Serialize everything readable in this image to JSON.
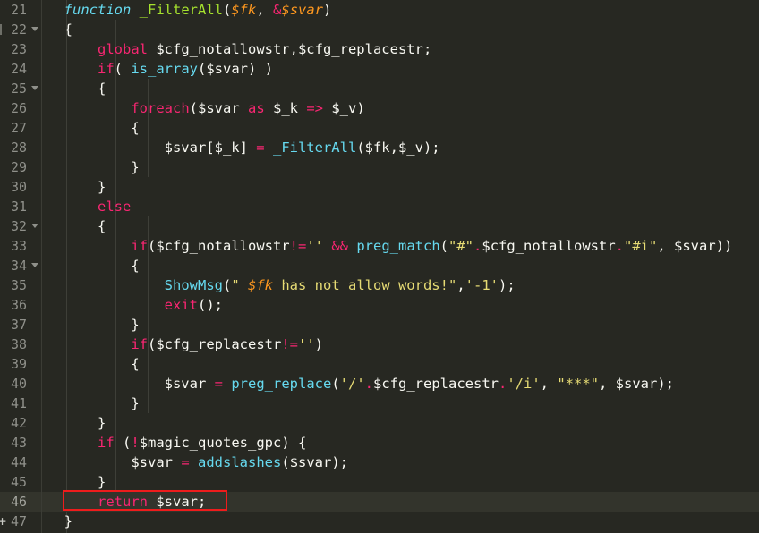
{
  "editor": {
    "theme_name": "monokai",
    "colors": {
      "background": "#272822",
      "gutter_background": "#272822",
      "gutter_text": "#8f908a",
      "current_line_background": "#33342c",
      "default_text": "#f8f8f2",
      "keyword": "#f92672",
      "function_name": "#a6e22e",
      "builtin_call": "#66d9ef",
      "parameter": "#fd971f",
      "string": "#e6db74",
      "indent_guide": "#3e3f38",
      "annotation_red": "#ee1c1c"
    },
    "language": "php",
    "current_line_number": 46,
    "first_line_number": 21,
    "last_line_number": 47
  },
  "annotation": {
    "type": "rectangle-highlight",
    "color": "#ee1c1c",
    "target_line": 46,
    "target_text": "return $svar;"
  },
  "lines": [
    {
      "number": "21",
      "fold": "none",
      "edge_tick": false,
      "tokens": [
        {
          "text": "  ",
          "cls": "punc"
        },
        {
          "text": "function",
          "cls": "kw-it"
        },
        {
          "text": " ",
          "cls": "punc"
        },
        {
          "text": "_FilterAll",
          "cls": "fn"
        },
        {
          "text": "(",
          "cls": "punc"
        },
        {
          "text": "$fk",
          "cls": "param"
        },
        {
          "text": ", ",
          "cls": "punc"
        },
        {
          "text": "&",
          "cls": "op"
        },
        {
          "text": "$svar",
          "cls": "param"
        },
        {
          "text": ")",
          "cls": "punc"
        }
      ]
    },
    {
      "number": "22",
      "fold": "open",
      "edge_tick": true,
      "tokens": [
        {
          "text": "  {",
          "cls": "punc"
        }
      ]
    },
    {
      "number": "23",
      "fold": "none",
      "edge_tick": false,
      "tokens": [
        {
          "text": "      ",
          "cls": "punc"
        },
        {
          "text": "global",
          "cls": "kw"
        },
        {
          "text": " $cfg_notallowstr,$cfg_replacestr;",
          "cls": "var"
        }
      ]
    },
    {
      "number": "24",
      "fold": "none",
      "edge_tick": false,
      "tokens": [
        {
          "text": "      ",
          "cls": "punc"
        },
        {
          "text": "if",
          "cls": "kw"
        },
        {
          "text": "( ",
          "cls": "punc"
        },
        {
          "text": "is_array",
          "cls": "call"
        },
        {
          "text": "($svar) )",
          "cls": "punc"
        }
      ]
    },
    {
      "number": "25",
      "fold": "open",
      "edge_tick": false,
      "tokens": [
        {
          "text": "      {",
          "cls": "punc"
        }
      ]
    },
    {
      "number": "26",
      "fold": "none",
      "edge_tick": false,
      "tokens": [
        {
          "text": "          ",
          "cls": "punc"
        },
        {
          "text": "foreach",
          "cls": "kw"
        },
        {
          "text": "($svar ",
          "cls": "punc"
        },
        {
          "text": "as",
          "cls": "kw"
        },
        {
          "text": " $_k ",
          "cls": "punc"
        },
        {
          "text": "=>",
          "cls": "op"
        },
        {
          "text": " $_v)",
          "cls": "punc"
        }
      ]
    },
    {
      "number": "27",
      "fold": "none",
      "edge_tick": false,
      "tokens": [
        {
          "text": "          {",
          "cls": "punc"
        }
      ]
    },
    {
      "number": "28",
      "fold": "none",
      "edge_tick": false,
      "tokens": [
        {
          "text": "              $svar[$_k] ",
          "cls": "punc"
        },
        {
          "text": "=",
          "cls": "op"
        },
        {
          "text": " ",
          "cls": "punc"
        },
        {
          "text": "_FilterAll",
          "cls": "call"
        },
        {
          "text": "($fk,$_v);",
          "cls": "punc"
        }
      ]
    },
    {
      "number": "29",
      "fold": "none",
      "edge_tick": false,
      "tokens": [
        {
          "text": "          }",
          "cls": "punc"
        }
      ]
    },
    {
      "number": "30",
      "fold": "none",
      "edge_tick": false,
      "tokens": [
        {
          "text": "      }",
          "cls": "punc"
        }
      ]
    },
    {
      "number": "31",
      "fold": "none",
      "edge_tick": false,
      "tokens": [
        {
          "text": "      ",
          "cls": "punc"
        },
        {
          "text": "else",
          "cls": "kw"
        }
      ]
    },
    {
      "number": "32",
      "fold": "open",
      "edge_tick": false,
      "tokens": [
        {
          "text": "      {",
          "cls": "punc"
        }
      ]
    },
    {
      "number": "33",
      "fold": "none",
      "edge_tick": false,
      "tokens": [
        {
          "text": "          ",
          "cls": "punc"
        },
        {
          "text": "if",
          "cls": "kw"
        },
        {
          "text": "($cfg_notallowstr",
          "cls": "punc"
        },
        {
          "text": "!=",
          "cls": "op"
        },
        {
          "text": "''",
          "cls": "str"
        },
        {
          "text": " ",
          "cls": "punc"
        },
        {
          "text": "&&",
          "cls": "op"
        },
        {
          "text": " ",
          "cls": "punc"
        },
        {
          "text": "preg_match",
          "cls": "call"
        },
        {
          "text": "(",
          "cls": "punc"
        },
        {
          "text": "\"#\"",
          "cls": "str"
        },
        {
          "text": ".",
          "cls": "dot"
        },
        {
          "text": "$cfg_notallowstr",
          "cls": "punc"
        },
        {
          "text": ".",
          "cls": "dot"
        },
        {
          "text": "\"#i\"",
          "cls": "str"
        },
        {
          "text": ", $svar))",
          "cls": "punc"
        }
      ]
    },
    {
      "number": "34",
      "fold": "open",
      "edge_tick": false,
      "tokens": [
        {
          "text": "          {",
          "cls": "punc"
        }
      ]
    },
    {
      "number": "35",
      "fold": "none",
      "edge_tick": false,
      "tokens": [
        {
          "text": "              ",
          "cls": "punc"
        },
        {
          "text": "ShowMsg",
          "cls": "call"
        },
        {
          "text": "(",
          "cls": "punc"
        },
        {
          "text": "\" ",
          "cls": "str"
        },
        {
          "text": "$fk",
          "cls": "param"
        },
        {
          "text": " has not allow words!\"",
          "cls": "str"
        },
        {
          "text": ",",
          "cls": "punc"
        },
        {
          "text": "'-1'",
          "cls": "str"
        },
        {
          "text": ");",
          "cls": "punc"
        }
      ]
    },
    {
      "number": "36",
      "fold": "none",
      "edge_tick": false,
      "tokens": [
        {
          "text": "              ",
          "cls": "punc"
        },
        {
          "text": "exit",
          "cls": "kw"
        },
        {
          "text": "();",
          "cls": "punc"
        }
      ]
    },
    {
      "number": "37",
      "fold": "none",
      "edge_tick": false,
      "tokens": [
        {
          "text": "          }",
          "cls": "punc"
        }
      ]
    },
    {
      "number": "38",
      "fold": "none",
      "edge_tick": false,
      "tokens": [
        {
          "text": "          ",
          "cls": "punc"
        },
        {
          "text": "if",
          "cls": "kw"
        },
        {
          "text": "($cfg_replacestr",
          "cls": "punc"
        },
        {
          "text": "!=",
          "cls": "op"
        },
        {
          "text": "''",
          "cls": "str"
        },
        {
          "text": ")",
          "cls": "punc"
        }
      ]
    },
    {
      "number": "39",
      "fold": "none",
      "edge_tick": false,
      "tokens": [
        {
          "text": "          {",
          "cls": "punc"
        }
      ]
    },
    {
      "number": "40",
      "fold": "none",
      "edge_tick": false,
      "tokens": [
        {
          "text": "              $svar ",
          "cls": "punc"
        },
        {
          "text": "=",
          "cls": "op"
        },
        {
          "text": " ",
          "cls": "punc"
        },
        {
          "text": "preg_replace",
          "cls": "call"
        },
        {
          "text": "(",
          "cls": "punc"
        },
        {
          "text": "'/'",
          "cls": "str"
        },
        {
          "text": ".",
          "cls": "dot"
        },
        {
          "text": "$cfg_replacestr",
          "cls": "punc"
        },
        {
          "text": ".",
          "cls": "dot"
        },
        {
          "text": "'/i'",
          "cls": "str"
        },
        {
          "text": ", ",
          "cls": "punc"
        },
        {
          "text": "\"***\"",
          "cls": "str"
        },
        {
          "text": ", $svar);",
          "cls": "punc"
        }
      ]
    },
    {
      "number": "41",
      "fold": "none",
      "edge_tick": false,
      "tokens": [
        {
          "text": "          }",
          "cls": "punc"
        }
      ]
    },
    {
      "number": "42",
      "fold": "none",
      "edge_tick": false,
      "tokens": [
        {
          "text": "      }",
          "cls": "punc"
        }
      ]
    },
    {
      "number": "43",
      "fold": "none",
      "edge_tick": false,
      "tokens": [
        {
          "text": "      ",
          "cls": "punc"
        },
        {
          "text": "if",
          "cls": "kw"
        },
        {
          "text": " (",
          "cls": "punc"
        },
        {
          "text": "!",
          "cls": "op"
        },
        {
          "text": "$magic_quotes_gpc) {",
          "cls": "punc"
        }
      ]
    },
    {
      "number": "44",
      "fold": "none",
      "edge_tick": false,
      "tokens": [
        {
          "text": "          $svar ",
          "cls": "punc"
        },
        {
          "text": "=",
          "cls": "op"
        },
        {
          "text": " ",
          "cls": "punc"
        },
        {
          "text": "addslashes",
          "cls": "call"
        },
        {
          "text": "($svar);",
          "cls": "punc"
        }
      ]
    },
    {
      "number": "45",
      "fold": "none",
      "edge_tick": false,
      "tokens": [
        {
          "text": "      }",
          "cls": "punc"
        }
      ]
    },
    {
      "number": "46",
      "fold": "none",
      "edge_tick": false,
      "current": true,
      "tokens": [
        {
          "text": "      ",
          "cls": "punc"
        },
        {
          "text": "return",
          "cls": "kw"
        },
        {
          "text": " $svar;",
          "cls": "punc"
        }
      ]
    },
    {
      "number": "47",
      "fold": "plus",
      "edge_tick": false,
      "tokens": [
        {
          "text": "  }",
          "cls": "punc"
        }
      ]
    }
  ]
}
